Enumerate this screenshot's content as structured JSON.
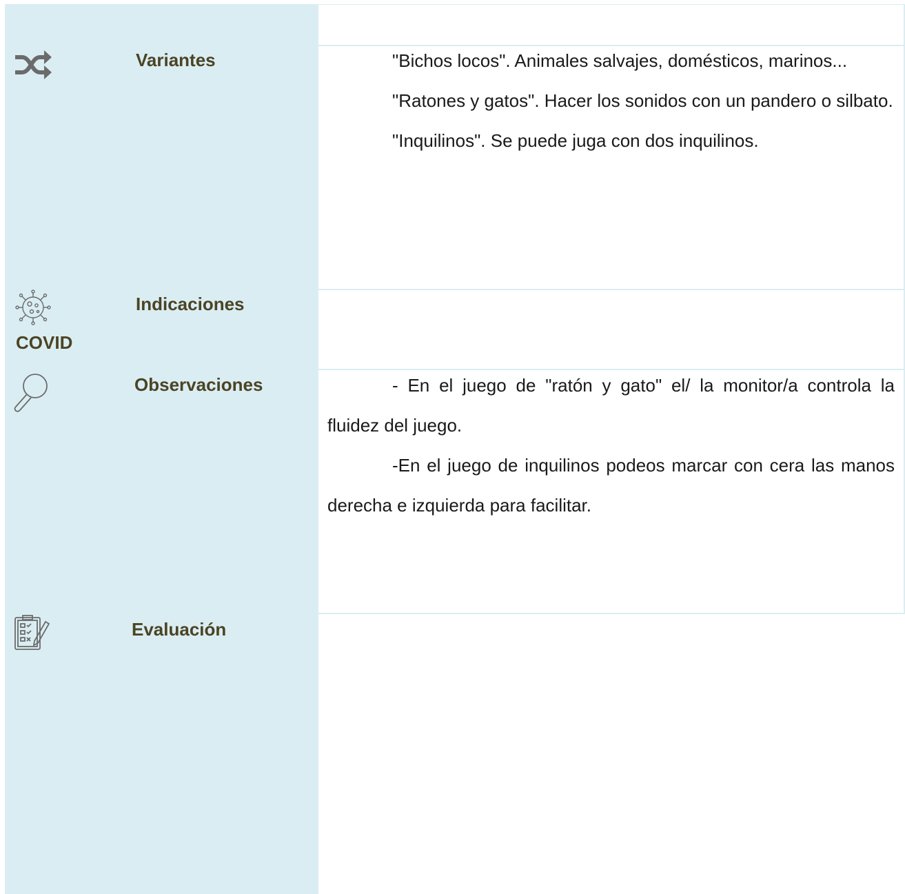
{
  "rows": {
    "variantes": {
      "label": "Variantes",
      "icon": "shuffle-icon",
      "paragraphs": [
        "\"Bichos locos\". Animales salvajes, domésticos, marinos...",
        "\"Ratones y gatos\". Hacer los sonidos con un pandero o silbato.",
        "\"Inquilinos\". Se puede juga con dos inquilinos."
      ]
    },
    "indicaciones": {
      "label": "Indicaciones",
      "sublabel": "COVID",
      "icon": "virus-icon"
    },
    "observaciones": {
      "label": "Observaciones",
      "icon": "magnifier-icon",
      "paragraphs": [
        "- En el juego de \"ratón y gato\" el/ la monitor/a controla la fluidez del juego.",
        "-En el juego de inquilinos podeos marcar con cera las manos derecha e izquierda para facilitar."
      ]
    },
    "evaluacion": {
      "label": "Evaluación",
      "icon": "checklist-clipboard-icon"
    }
  },
  "colors": {
    "panel": "#daedf3",
    "label": "#4b4424",
    "icon": "#6b6b6b"
  }
}
